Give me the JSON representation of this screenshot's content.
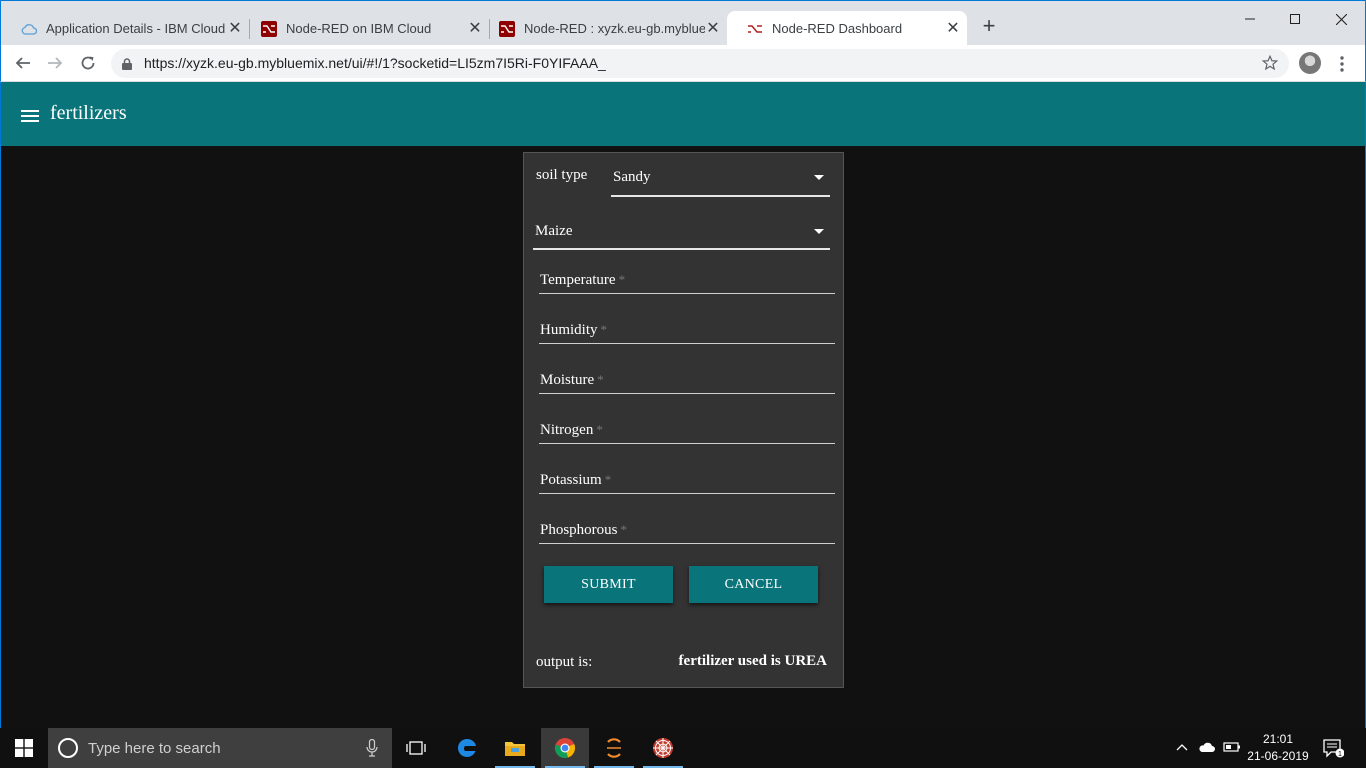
{
  "browser": {
    "tabs": [
      {
        "title": "Application Details - IBM Cloud",
        "icon": "cloud-icon",
        "active": false
      },
      {
        "title": "Node-RED on IBM Cloud",
        "icon": "node-red-icon",
        "active": false
      },
      {
        "title": "Node-RED : xyzk.eu-gb.mybluemix.net",
        "icon": "node-red-icon",
        "active": false
      },
      {
        "title": "Node-RED Dashboard",
        "icon": "node-red-dashboard-icon",
        "active": true
      }
    ],
    "close_glyph": "✕",
    "new_tab_glyph": "+",
    "url": "https://xyzk.eu-gb.mybluemix.net/ui/#!/1?socketid=LI5zm7I5Ri-F0YIFAAA_"
  },
  "app": {
    "title": "fertilizers",
    "header_color": "#097479"
  },
  "form": {
    "soil_type_label": "soil type",
    "soil_type_value": "Sandy",
    "crop_value": "Maize",
    "fields": [
      {
        "label": "Temperature",
        "required": "*"
      },
      {
        "label": "Humidity",
        "required": "*"
      },
      {
        "label": "Moisture",
        "required": "*"
      },
      {
        "label": "Nitrogen",
        "required": "*"
      },
      {
        "label": "Potassium",
        "required": "*"
      },
      {
        "label": "Phosphorous",
        "required": "*"
      }
    ],
    "submit_label": "SUBMIT",
    "cancel_label": "CANCEL",
    "output_label": "output is:",
    "output_value": "fertilizer used is UREA"
  },
  "taskbar": {
    "search_placeholder": "Type here to search",
    "time": "21:01",
    "date": "21-06-2019",
    "notification_count": "1",
    "pinned": [
      "task-view-icon",
      "edge-icon",
      "file-explorer-icon",
      "chrome-icon",
      "eclipse-icon",
      "spider-web-icon"
    ]
  }
}
